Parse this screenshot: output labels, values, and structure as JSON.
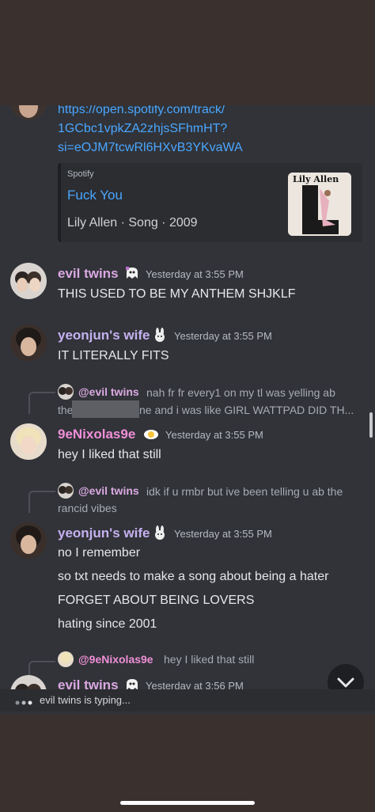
{
  "colors": {
    "background": "#3a302e",
    "chat_bg": "#313338",
    "link": "#4aa6ff",
    "evil_twins": "#dba9e3",
    "yeonjun_wife": "#c6b1f0",
    "nixolas": "#f08fd8",
    "timestamp": "#b5bac1"
  },
  "link_message": {
    "lines": [
      "https://open.spotify.com/track/",
      "1GCbc1vpkZA2zhjsSFhmHT?",
      "si=eOJM7tcwRl6HXvB3YKvaWA"
    ]
  },
  "embed": {
    "provider": "Spotify",
    "title": "Fuck You",
    "description": "Lily Allen · Song · 2009",
    "cover_artist": "Lily Allen"
  },
  "messages": [
    {
      "author": "evil twins",
      "badge": "ghost-icon",
      "timestamp": "Yesterday at 3:55 PM",
      "lines": [
        "THIS USED TO BE MY ANTHEM SHJKLF"
      ]
    },
    {
      "author": "yeonjun's wife",
      "badge": "bunny-icon",
      "timestamp": "Yesterday at 3:55 PM",
      "lines": [
        "IT LITERALLY FITS"
      ]
    },
    {
      "reply_to": "@evil twins",
      "reply_text": "nah fr fr every1 on my tl was yelling ab",
      "reply_text2": "the",
      "reply_text3": "ne and i was like GIRL WATTPAD DID TH...",
      "author": "9eNixolas9e",
      "badge": "egg-icon",
      "timestamp": "Yesterday at 3:55 PM",
      "lines": [
        "hey I liked that still"
      ]
    },
    {
      "reply_to": "@evil twins",
      "reply_text": "idk if u rmbr but ive been telling u ab the",
      "reply_text2": "rancid vibes",
      "author": "yeonjun's wife",
      "badge": "bunny-icon",
      "timestamp": "Yesterday at 3:55 PM",
      "lines": [
        "no I remember",
        "so txt needs to make a song about being a hater",
        "FORGET ABOUT BEING LOVERS",
        "hating since 2001"
      ]
    },
    {
      "reply_to": "@9eNixolas9e",
      "reply_text": "hey I liked that still",
      "author": "evil twins",
      "badge": "ghost-icon",
      "timestamp": "Yesterday at 3:56 PM",
      "lines": []
    }
  ],
  "typing": "evil twins is typing..."
}
